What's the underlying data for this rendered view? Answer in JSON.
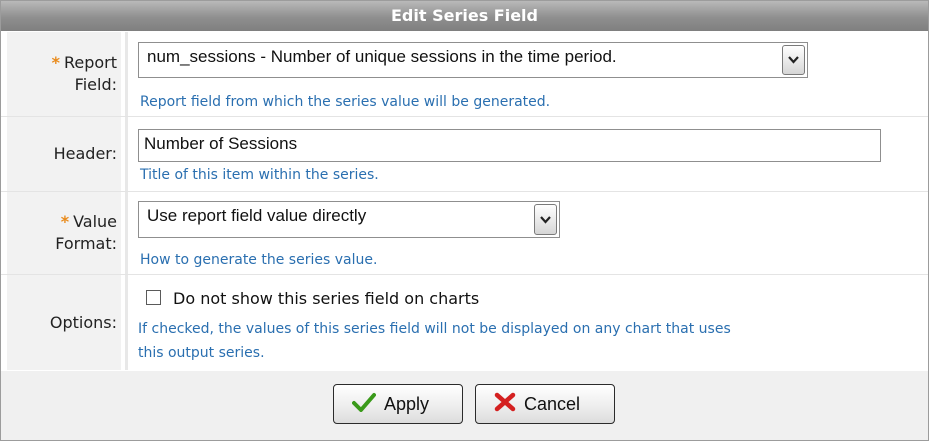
{
  "dialog": {
    "title": "Edit Series Field"
  },
  "report_field": {
    "required_mark": "*",
    "label_line1": "Report",
    "label_line2": "Field:",
    "selected": "num_sessions - Number of unique sessions in the time period.",
    "help": "Report field from which the series value will be generated."
  },
  "header_field": {
    "label": "Header:",
    "value": "Number of Sessions",
    "help": "Title of this item within the series."
  },
  "value_format": {
    "required_mark": "*",
    "label_line1": "Value",
    "label_line2": "Format:",
    "selected": "Use report field value directly",
    "help": "How to generate the series value."
  },
  "options": {
    "label": "Options:",
    "checkbox_label": "Do not show this series field on charts",
    "checked": false,
    "help_line1": "If checked, the values of this series field will not be displayed on any chart that uses",
    "help_line2": "this output series."
  },
  "buttons": {
    "apply": "Apply",
    "cancel": "Cancel"
  },
  "colors": {
    "required": "#e98a1a",
    "help_text": "#2a6fb0",
    "apply_check": "#3a9a1a",
    "cancel_x": "#d42020"
  },
  "icons": {
    "apply": "checkmark-icon",
    "cancel": "x-icon",
    "dropdown": "chevron-down-icon"
  }
}
